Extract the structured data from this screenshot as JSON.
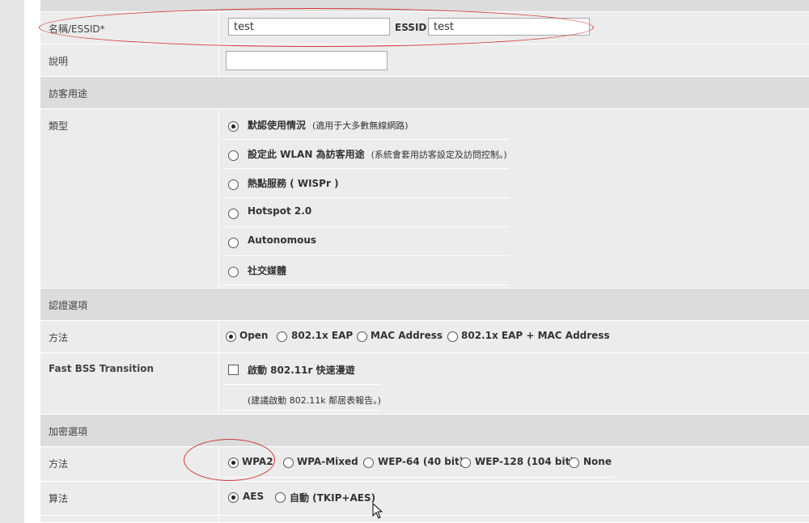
{
  "name_row": {
    "label": "名稱/ESSID*",
    "name_value": "test",
    "essid_label": "ESSID",
    "essid_value": "test"
  },
  "description_row": {
    "label": "說明",
    "value": ""
  },
  "guest_section": {
    "title": "訪客用途"
  },
  "type_row": {
    "label": "類型",
    "options": [
      {
        "label": "默認使用情況",
        "note": "(適用于大多數無線網路)",
        "selected": true
      },
      {
        "label": "設定此 WLAN 為訪客用途",
        "note": "(系統會套用訪客設定及訪問控制。)",
        "selected": false
      },
      {
        "label": "熱點服務 ( WISPr )",
        "note": "",
        "selected": false
      },
      {
        "label": "Hotspot 2.0",
        "note": "",
        "selected": false
      },
      {
        "label": "Autonomous",
        "note": "",
        "selected": false
      },
      {
        "label": "社交媒體",
        "note": "",
        "selected": false
      }
    ]
  },
  "auth_section": {
    "title": "認證選項"
  },
  "auth_method_row": {
    "label": "方法",
    "options": [
      {
        "label": "Open",
        "selected": true
      },
      {
        "label": "802.1x EAP",
        "selected": false
      },
      {
        "label": "MAC Address",
        "selected": false
      },
      {
        "label": "802.1x EAP + MAC Address",
        "selected": false
      }
    ]
  },
  "fast_bss_row": {
    "label": "Fast BSS Transition",
    "checkbox_label": "啟動 802.11r 快速漫遊",
    "checked": false,
    "hint": "(建議啟動 802.11k 鄰居表報告。)"
  },
  "encryption_section": {
    "title": "加密選項"
  },
  "enc_method_row": {
    "label": "方法",
    "options": [
      {
        "label": "WPA2",
        "selected": true
      },
      {
        "label": "WPA-Mixed",
        "selected": false
      },
      {
        "label": "WEP-64 (40 bit)",
        "selected": false
      },
      {
        "label": "WEP-128 (104 bit)",
        "selected": false
      },
      {
        "label": "None",
        "selected": false
      }
    ]
  },
  "algorithm_row": {
    "label": "算法",
    "options": [
      {
        "label": "AES",
        "selected": true
      },
      {
        "label": "自動 (TKIP+AES)",
        "selected": false
      }
    ]
  },
  "annotation_color": "#d23a3a"
}
